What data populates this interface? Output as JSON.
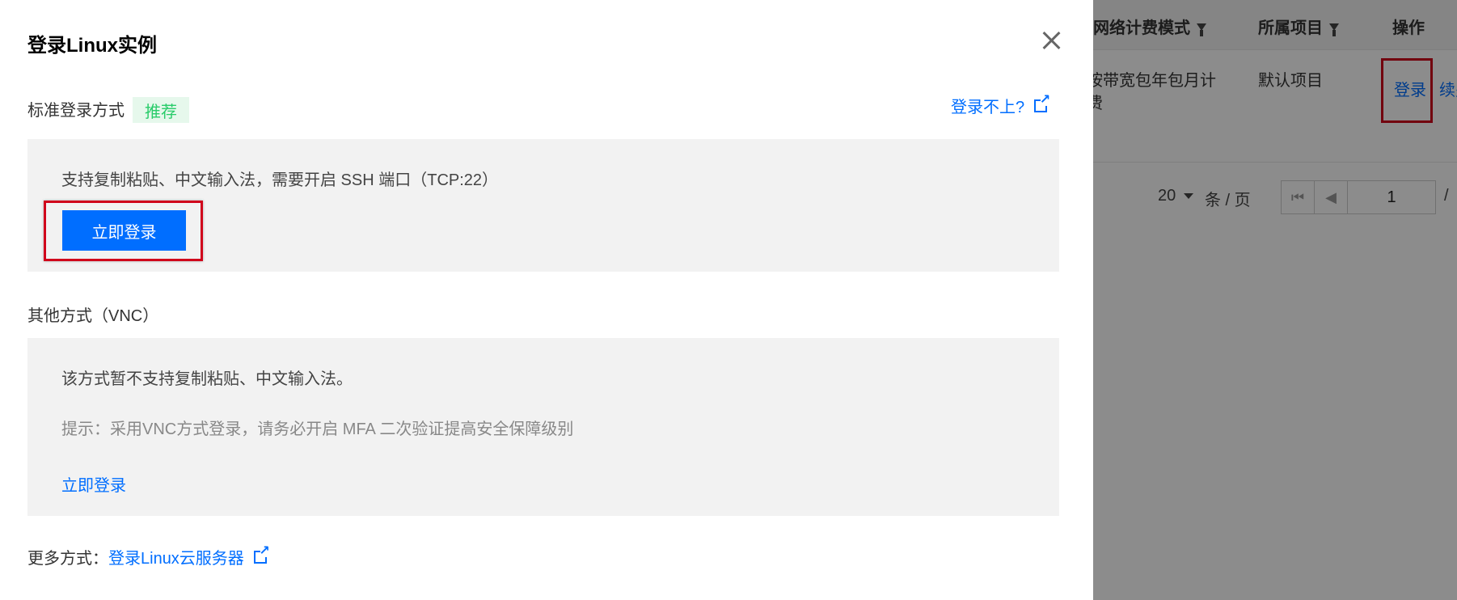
{
  "background": {
    "columns": [
      {
        "label": "网络计费模式"
      },
      {
        "label": "所属项目"
      },
      {
        "label": "操作"
      }
    ],
    "row": {
      "billing_mode_line1": "按带宽包年包月计",
      "billing_mode_line2": "费",
      "project": "默认项目",
      "action_login": "登录",
      "action_more": "续费"
    },
    "pager": {
      "page_size": "20",
      "per_page_label": "条 / 页",
      "current_page": "1",
      "page_sep": "/"
    }
  },
  "dialog": {
    "title": "登录Linux实例",
    "close_icon": "close-icon",
    "standard": {
      "label": "标准登录方式",
      "tag": "推荐",
      "help_link": "登录不上?",
      "description": "支持复制粘贴、中文输入法，需要开启 SSH 端口（TCP:22）",
      "login_button": "立即登录"
    },
    "vnc": {
      "label": "其他方式（VNC）",
      "description": "该方式暂不支持复制粘贴、中文输入法。",
      "hint": "提示：采用VNC方式登录，请务必开启 MFA 二次验证提高安全保障级别",
      "login_link": "立即登录"
    },
    "more": {
      "label": "更多方式：",
      "link": "登录Linux云服务器"
    }
  },
  "colors": {
    "primary": "#006eff",
    "recommend_tag_bg": "#e6f8ec",
    "recommend_tag_text": "#29cc6a",
    "highlight_border": "#d0021b",
    "panel_bg": "#f2f2f2"
  }
}
